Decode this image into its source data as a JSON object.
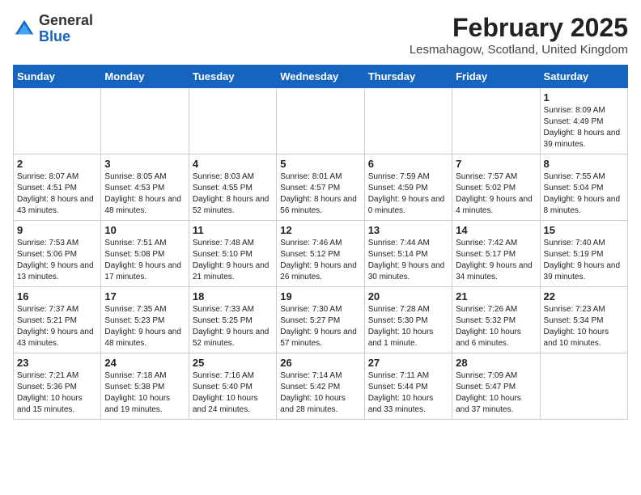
{
  "header": {
    "logo_general": "General",
    "logo_blue": "Blue",
    "month_title": "February 2025",
    "location": "Lesmahagow, Scotland, United Kingdom"
  },
  "weekdays": [
    "Sunday",
    "Monday",
    "Tuesday",
    "Wednesday",
    "Thursday",
    "Friday",
    "Saturday"
  ],
  "weeks": [
    [
      {
        "num": "",
        "info": ""
      },
      {
        "num": "",
        "info": ""
      },
      {
        "num": "",
        "info": ""
      },
      {
        "num": "",
        "info": ""
      },
      {
        "num": "",
        "info": ""
      },
      {
        "num": "",
        "info": ""
      },
      {
        "num": "1",
        "info": "Sunrise: 8:09 AM\nSunset: 4:49 PM\nDaylight: 8 hours and 39 minutes."
      }
    ],
    [
      {
        "num": "2",
        "info": "Sunrise: 8:07 AM\nSunset: 4:51 PM\nDaylight: 8 hours and 43 minutes."
      },
      {
        "num": "3",
        "info": "Sunrise: 8:05 AM\nSunset: 4:53 PM\nDaylight: 8 hours and 48 minutes."
      },
      {
        "num": "4",
        "info": "Sunrise: 8:03 AM\nSunset: 4:55 PM\nDaylight: 8 hours and 52 minutes."
      },
      {
        "num": "5",
        "info": "Sunrise: 8:01 AM\nSunset: 4:57 PM\nDaylight: 8 hours and 56 minutes."
      },
      {
        "num": "6",
        "info": "Sunrise: 7:59 AM\nSunset: 4:59 PM\nDaylight: 9 hours and 0 minutes."
      },
      {
        "num": "7",
        "info": "Sunrise: 7:57 AM\nSunset: 5:02 PM\nDaylight: 9 hours and 4 minutes."
      },
      {
        "num": "8",
        "info": "Sunrise: 7:55 AM\nSunset: 5:04 PM\nDaylight: 9 hours and 8 minutes."
      }
    ],
    [
      {
        "num": "9",
        "info": "Sunrise: 7:53 AM\nSunset: 5:06 PM\nDaylight: 9 hours and 13 minutes."
      },
      {
        "num": "10",
        "info": "Sunrise: 7:51 AM\nSunset: 5:08 PM\nDaylight: 9 hours and 17 minutes."
      },
      {
        "num": "11",
        "info": "Sunrise: 7:48 AM\nSunset: 5:10 PM\nDaylight: 9 hours and 21 minutes."
      },
      {
        "num": "12",
        "info": "Sunrise: 7:46 AM\nSunset: 5:12 PM\nDaylight: 9 hours and 26 minutes."
      },
      {
        "num": "13",
        "info": "Sunrise: 7:44 AM\nSunset: 5:14 PM\nDaylight: 9 hours and 30 minutes."
      },
      {
        "num": "14",
        "info": "Sunrise: 7:42 AM\nSunset: 5:17 PM\nDaylight: 9 hours and 34 minutes."
      },
      {
        "num": "15",
        "info": "Sunrise: 7:40 AM\nSunset: 5:19 PM\nDaylight: 9 hours and 39 minutes."
      }
    ],
    [
      {
        "num": "16",
        "info": "Sunrise: 7:37 AM\nSunset: 5:21 PM\nDaylight: 9 hours and 43 minutes."
      },
      {
        "num": "17",
        "info": "Sunrise: 7:35 AM\nSunset: 5:23 PM\nDaylight: 9 hours and 48 minutes."
      },
      {
        "num": "18",
        "info": "Sunrise: 7:33 AM\nSunset: 5:25 PM\nDaylight: 9 hours and 52 minutes."
      },
      {
        "num": "19",
        "info": "Sunrise: 7:30 AM\nSunset: 5:27 PM\nDaylight: 9 hours and 57 minutes."
      },
      {
        "num": "20",
        "info": "Sunrise: 7:28 AM\nSunset: 5:30 PM\nDaylight: 10 hours and 1 minute."
      },
      {
        "num": "21",
        "info": "Sunrise: 7:26 AM\nSunset: 5:32 PM\nDaylight: 10 hours and 6 minutes."
      },
      {
        "num": "22",
        "info": "Sunrise: 7:23 AM\nSunset: 5:34 PM\nDaylight: 10 hours and 10 minutes."
      }
    ],
    [
      {
        "num": "23",
        "info": "Sunrise: 7:21 AM\nSunset: 5:36 PM\nDaylight: 10 hours and 15 minutes."
      },
      {
        "num": "24",
        "info": "Sunrise: 7:18 AM\nSunset: 5:38 PM\nDaylight: 10 hours and 19 minutes."
      },
      {
        "num": "25",
        "info": "Sunrise: 7:16 AM\nSunset: 5:40 PM\nDaylight: 10 hours and 24 minutes."
      },
      {
        "num": "26",
        "info": "Sunrise: 7:14 AM\nSunset: 5:42 PM\nDaylight: 10 hours and 28 minutes."
      },
      {
        "num": "27",
        "info": "Sunrise: 7:11 AM\nSunset: 5:44 PM\nDaylight: 10 hours and 33 minutes."
      },
      {
        "num": "28",
        "info": "Sunrise: 7:09 AM\nSunset: 5:47 PM\nDaylight: 10 hours and 37 minutes."
      },
      {
        "num": "",
        "info": ""
      }
    ]
  ]
}
